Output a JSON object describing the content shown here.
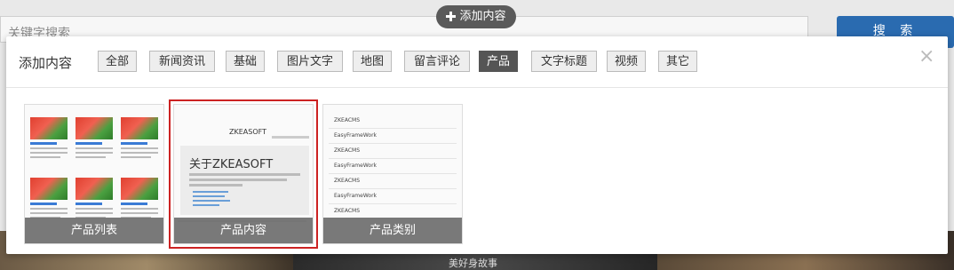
{
  "background": {
    "search_placeholder": "关键字搜索",
    "search_button": "搜 索",
    "strip_caption": "美好身故事"
  },
  "add_pill": {
    "label": "添加内容",
    "icon": "plus-icon"
  },
  "modal": {
    "title": "添加内容",
    "close_icon": "close-icon",
    "tabs": [
      {
        "label": "全部",
        "active": false
      },
      {
        "label": "新闻资讯",
        "active": false
      },
      {
        "label": "基础",
        "active": false
      },
      {
        "label": "图片文字",
        "active": false
      },
      {
        "label": "地图",
        "active": false
      },
      {
        "label": "留言评论",
        "active": false
      },
      {
        "label": "产品",
        "active": true
      },
      {
        "label": "文字标题",
        "active": false
      },
      {
        "label": "视频",
        "active": false
      },
      {
        "label": "其它",
        "active": false
      }
    ],
    "widgets": [
      {
        "label": "产品列表",
        "selected": false
      },
      {
        "label": "产品内容",
        "selected": true
      },
      {
        "label": "产品类别",
        "selected": false
      }
    ],
    "preview_product_content": {
      "brand": "ZKEASOFT",
      "heading": "关于ZKEASOFT"
    },
    "preview_category": {
      "items": [
        "ZKEACMS",
        "EasyFrameWork",
        "ZKEACMS",
        "EasyFrameWork",
        "ZKEACMS",
        "EasyFrameWork",
        "ZKEACMS"
      ]
    }
  }
}
